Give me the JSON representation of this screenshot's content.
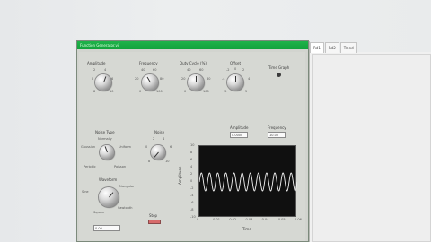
{
  "tabs": [
    "Rd1",
    "Rd2",
    "Trend"
  ],
  "vi": {
    "title": "Function Generator.vi",
    "knobs": {
      "amplitude": {
        "label": "Amplitude",
        "scale": [
          "0",
          "2",
          "4",
          "6",
          "8",
          "10"
        ]
      },
      "frequency": {
        "label": "Frequency",
        "scale": [
          "40",
          "60",
          "80",
          "100",
          "20",
          "0"
        ]
      },
      "duty_cycle": {
        "label": "Duty Cycle (%)",
        "scale": [
          "40",
          "60",
          "80",
          "20",
          "0",
          "100"
        ]
      },
      "offset": {
        "label": "Offset",
        "scale": [
          "-2",
          "0",
          "2",
          "-4",
          "4",
          "-5",
          "5"
        ]
      },
      "noise_type": {
        "label": "Noise Type",
        "options": [
          "Normally",
          "Gaussian",
          "Uniform",
          "Periodic",
          "Poisson"
        ]
      },
      "noise": {
        "label": "Noise",
        "scale": [
          "2",
          "4",
          "6",
          "0",
          "8",
          "10"
        ]
      },
      "waveform": {
        "label": "Waveform",
        "options": [
          "Sine",
          "Triangular",
          "Square",
          "Sawtooth"
        ]
      }
    },
    "time_graph_label": "Time Graph",
    "amplitude_out": {
      "label": "Amplitude",
      "value": "0.0000"
    },
    "frequency_out": {
      "label": "Frequency",
      "value": "10.00"
    },
    "stop_label": "Stop",
    "output_field": "0.00",
    "graph": {
      "ylabel": "Amplitude",
      "xlabel": "Time",
      "y_ticks": [
        "10",
        "8",
        "6",
        "4",
        "2",
        "0",
        "-2",
        "-4",
        "-6",
        "-8",
        "-10"
      ],
      "x_ticks": [
        "0",
        "0.01",
        "0.02",
        "0.03",
        "0.04",
        "0.05",
        "0.06"
      ]
    }
  },
  "chart_data": {
    "type": "line",
    "xlabel": "Time",
    "ylabel": "Amplitude",
    "xlim": [
      0,
      0.06
    ],
    "ylim": [
      -10,
      10
    ],
    "series": [
      {
        "frequency_hz": 200,
        "amplitude": 2.5,
        "offset": 0
      }
    ]
  }
}
